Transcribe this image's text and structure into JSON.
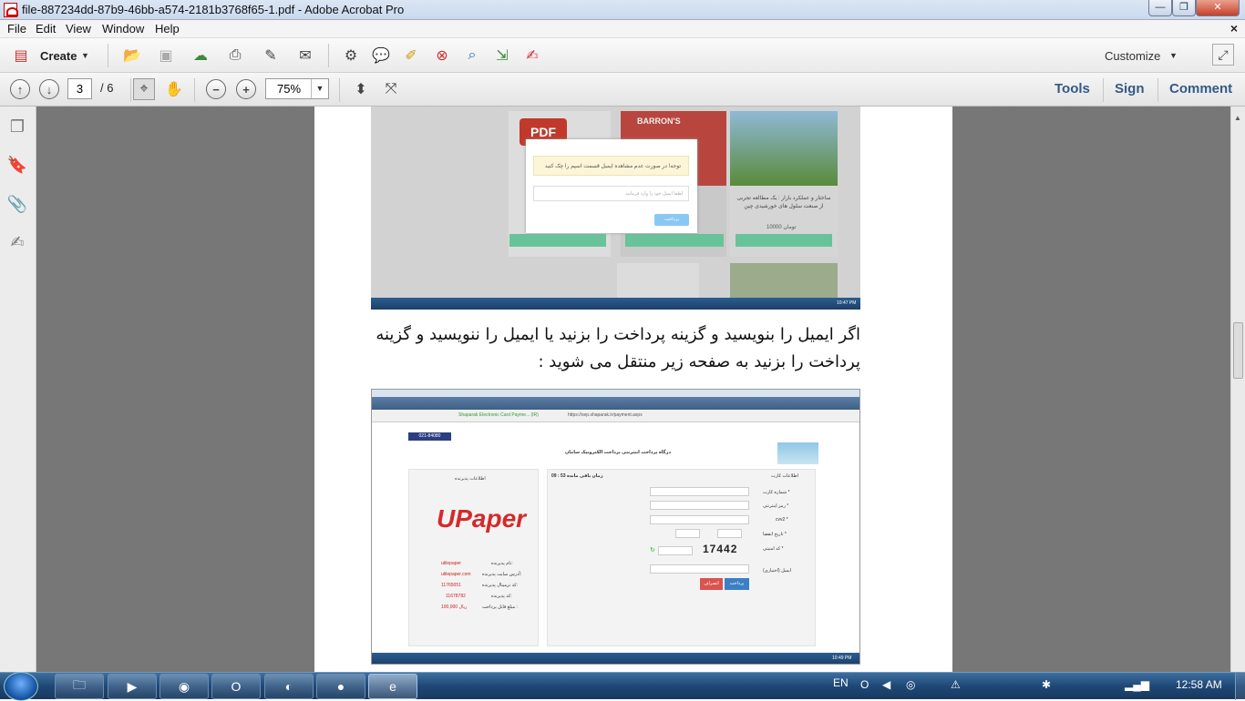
{
  "window": {
    "title": "file-887234dd-87b9-46bb-a574-2181b3768f65-1.pdf - Adobe Acrobat Pro",
    "minimize": "—",
    "restore": "❐",
    "close": "✕"
  },
  "menu": {
    "items": [
      "File",
      "Edit",
      "View",
      "Window",
      "Help"
    ],
    "close": "×"
  },
  "toolbar": {
    "create_label": "Create",
    "customize_label": "Customize"
  },
  "nav": {
    "current_page": "3",
    "total_pages": "/ 6",
    "zoom": "75%"
  },
  "right_links": {
    "tools": "Tools",
    "sign": "Sign",
    "comment": "Comment"
  },
  "document": {
    "paragraph": "اگر ایمیل را بنویسید و گزینه پرداخت را بزنید یا ایمیل را ننویسید و گزینه پرداخت را بزنید به صفحه زیر منتقل می شوید :",
    "shot1": {
      "modal_note": "توجه! در صورت عدم مشاهده ایمیل قسمت اسپم را چک کنید",
      "modal_placeholder": "لطفا ایمیل خود را وارد فرمایید",
      "modal_button": "پرداخت",
      "card_title": "ساختار و عملکرد بازار : یک مطالعه تجربی از صنعت سلول های خورشیدی چین",
      "card_price": "10000 تومان",
      "card_brand_pdf": "PDF",
      "card_brand_book": "BARRON'S",
      "time": "10:47 PM"
    },
    "shot2": {
      "phone": "021-84080",
      "gateway_title": "درگاه پرداخت اینترنتی پرداخت الکترونیک سامان",
      "address": "https://sep.shaparak.ir/payment.aspx",
      "url_label": "Shaparak Electronic Card Payme... (IR)",
      "timer": "زمان باقی مانده 53 : 09",
      "card_info": "اطلاعات کارت",
      "merchant_info": "اطلاعات پذیرنده",
      "field_card": "شماره کارت *",
      "field_pin": "رمز اینترنتی *",
      "field_cvv": "cvv2 *",
      "field_expire": "تاریخ انقضا *",
      "field_captcha": "کد امنیتی *",
      "field_email": "ایمیل (اختیاری)",
      "captcha_text": "17442",
      "pay_button": "پرداخت",
      "cancel_button": "انصراف",
      "merchant_name_label": "نام پذیرنده:",
      "merchant_name": "utilepaper",
      "merchant_site_label": "آدرس سایت پذیرنده:",
      "merchant_site": "utilepaper.com",
      "terminal_label": "کد ترمینال پذیرنده:",
      "terminal": "11765051",
      "merchant_code_label": "کد پذیرنده:",
      "merchant_code": "11678782",
      "amount_label": "مبلغ قابل پرداخت :",
      "amount": "100,000 ریال",
      "logo": "UPaper",
      "time": "10:49 PM"
    }
  },
  "taskbar": {
    "lang": "EN",
    "clock": "12:58 AM"
  }
}
